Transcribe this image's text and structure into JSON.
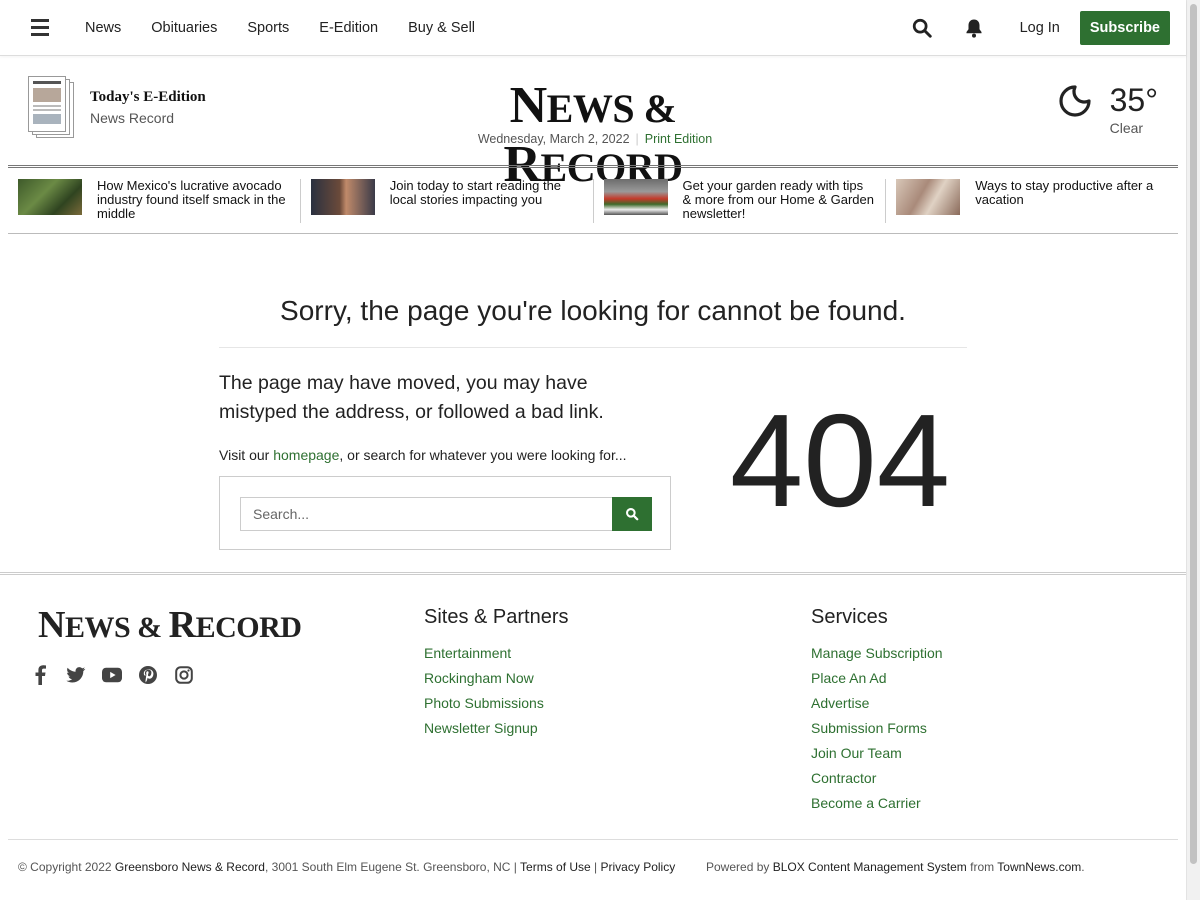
{
  "nav": {
    "items": [
      "News",
      "Obituaries",
      "Sports",
      "E-Edition",
      "Buy & Sell"
    ],
    "login": "Log In",
    "subscribe": "Subscribe"
  },
  "masthead": {
    "eedition_title": "Today's E-Edition",
    "eedition_sub": "News Record",
    "logo": {
      "n": "N",
      "ews": "EWS",
      "amp": " & ",
      "r": "R",
      "ecord": "ECORD"
    },
    "date": "Wednesday, March 2, 2022",
    "print_edition": "Print Edition",
    "weather": {
      "temp": "35°",
      "condition": "Clear"
    }
  },
  "headlines": [
    {
      "text": "How Mexico's lucrative avocado industry found itself smack in the middle"
    },
    {
      "text": "Join today to start reading the local stories impacting you"
    },
    {
      "text": "Get your garden ready with tips & more from our Home & Garden newsletter!"
    },
    {
      "text": "Ways to stay productive after a vacation"
    }
  ],
  "notfound": {
    "title": "Sorry, the page you're looking for cannot be found.",
    "message": "The page may have moved, you may have mistyped the address, or followed a bad link.",
    "visit_prefix": "Visit our ",
    "homepage_link": "homepage",
    "visit_suffix": ", or search for whatever you were looking for...",
    "search_placeholder": "Search...",
    "code": "404"
  },
  "footer": {
    "sites_title": "Sites & Partners",
    "sites": [
      "Entertainment",
      "Rockingham Now",
      "Photo Submissions",
      "Newsletter Signup"
    ],
    "services_title": "Services",
    "services": [
      "Manage Subscription",
      "Place An Ad",
      "Advertise",
      "Submission Forms",
      "Join Our Team",
      "Contractor",
      "Become a Carrier"
    ],
    "copyright_prefix": "© Copyright 2022 ",
    "copyright_owner": "Greensboro News & Record",
    "copyright_address": ", 3001 South Elm Eugene St. Greensboro, NC | ",
    "terms": "Terms of Use",
    "sep": " | ",
    "privacy": "Privacy Policy",
    "powered_prefix": "Powered by ",
    "powered_cms": "BLOX Content Management System",
    "powered_from": " from ",
    "powered_vendor": "TownNews.com",
    "powered_end": "."
  },
  "colors": {
    "accent": "#2e7031"
  },
  "icons": [
    "menu-icon",
    "search-icon",
    "bell-icon",
    "moon-icon",
    "facebook-icon",
    "twitter-icon",
    "youtube-icon",
    "pinterest-icon",
    "instagram-icon"
  ]
}
